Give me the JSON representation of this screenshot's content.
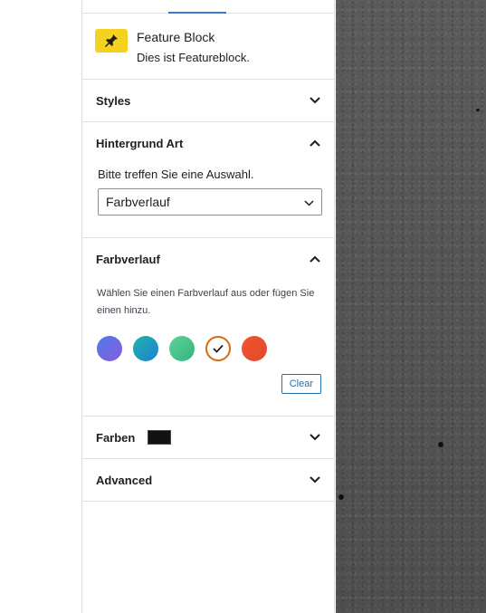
{
  "block": {
    "title": "Feature Block",
    "description": "Dies ist Featureblock.",
    "icon": "pin-icon",
    "icon_bg": "#f5d21f"
  },
  "panels": {
    "styles": {
      "label": "Styles",
      "expanded": false
    },
    "background_type": {
      "label": "Hintergrund Art",
      "expanded": true,
      "field_label": "Bitte treffen Sie eine Auswahl.",
      "selected": "Farbverlauf"
    },
    "gradient": {
      "label": "Farbverlauf",
      "expanded": true,
      "help": "Wählen Sie einen Farbverlauf aus oder fügen Sie einen hinzu.",
      "swatches": [
        {
          "name": "blue-purple",
          "from": "#4b7be8",
          "to": "#8a5be0",
          "selected": false
        },
        {
          "name": "teal-blue",
          "from": "#1fb5a8",
          "to": "#1d7fd1",
          "selected": false
        },
        {
          "name": "green",
          "from": "#5fd39a",
          "to": "#34b37c",
          "selected": false
        },
        {
          "name": "selected",
          "selected": true
        },
        {
          "name": "orange-red",
          "from": "#f2552f",
          "to": "#e0492a",
          "selected": false
        }
      ],
      "clear_label": "Clear"
    },
    "colors": {
      "label": "Farben",
      "expanded": false,
      "chip_color": "#111111"
    },
    "advanced": {
      "label": "Advanced",
      "expanded": false
    }
  },
  "colors": {
    "accent": "#2271b1",
    "tab_indicator": "#3a7bd5",
    "selected_ring": "#d46c12"
  }
}
